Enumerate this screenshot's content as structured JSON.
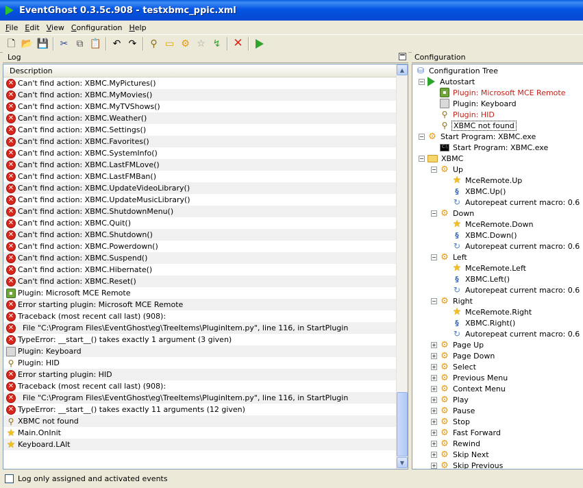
{
  "window": {
    "title": "EventGhost 0.3.5c.908 - testxbmc_ppic.xml"
  },
  "menu": [
    {
      "key": "F",
      "rest": "ile"
    },
    {
      "key": "E",
      "rest": "dit"
    },
    {
      "key": "V",
      "rest": "iew"
    },
    {
      "key": "C",
      "rest": "onfiguration"
    },
    {
      "key": "H",
      "rest": "elp"
    }
  ],
  "toolbar": {
    "icons": [
      "new-file-icon",
      "open-folder-icon",
      "save-icon",
      "cut-icon",
      "copy-icon",
      "paste-icon",
      "undo-icon",
      "redo-icon",
      "add-plugin-icon",
      "add-folder-icon",
      "add-macro-icon",
      "add-event-icon",
      "add-action-icon",
      "disable-icon",
      "execute-icon"
    ]
  },
  "log": {
    "title": "Log",
    "column": "Description",
    "rows": [
      {
        "icon": "error",
        "text": "Can't find action: XBMC.MyPictures()"
      },
      {
        "icon": "error",
        "text": "Can't find action: XBMC.MyMovies()"
      },
      {
        "icon": "error",
        "text": "Can't find action: XBMC.MyTVShows()"
      },
      {
        "icon": "error",
        "text": "Can't find action: XBMC.Weather()"
      },
      {
        "icon": "error",
        "text": "Can't find action: XBMC.Settings()"
      },
      {
        "icon": "error",
        "text": "Can't find action: XBMC.Favorites()"
      },
      {
        "icon": "error",
        "text": "Can't find action: XBMC.SystemInfo()"
      },
      {
        "icon": "error",
        "text": "Can't find action: XBMC.LastFMLove()"
      },
      {
        "icon": "error",
        "text": "Can't find action: XBMC.LastFMBan()"
      },
      {
        "icon": "error",
        "text": "Can't find action: XBMC.UpdateVideoLibrary()"
      },
      {
        "icon": "error",
        "text": "Can't find action: XBMC.UpdateMusicLibrary()"
      },
      {
        "icon": "error",
        "text": "Can't find action: XBMC.ShutdownMenu()"
      },
      {
        "icon": "error",
        "text": "Can't find action: XBMC.Quit()"
      },
      {
        "icon": "error",
        "text": "Can't find action: XBMC.Shutdown()"
      },
      {
        "icon": "error",
        "text": "Can't find action: XBMC.Powerdown()"
      },
      {
        "icon": "error",
        "text": "Can't find action: XBMC.Suspend()"
      },
      {
        "icon": "error",
        "text": "Can't find action: XBMC.Hibernate()"
      },
      {
        "icon": "error",
        "text": "Can't find action: XBMC.Reset()"
      },
      {
        "icon": "plugin",
        "text": "Plugin: Microsoft MCE Remote"
      },
      {
        "icon": "error",
        "text": "Error starting plugin: Microsoft MCE Remote"
      },
      {
        "icon": "error",
        "text": "Traceback (most recent call last) (908):"
      },
      {
        "icon": "error",
        "text": "  File \"C:\\Program Files\\EventGhost\\eg\\TreeItems\\PluginItem.py\", line 116, in StartPlugin"
      },
      {
        "icon": "error",
        "text": "TypeError: __start__() takes exactly 1 argument (3 given)"
      },
      {
        "icon": "keyboard",
        "text": "Plugin: Keyboard"
      },
      {
        "icon": "hid",
        "text": "Plugin: HID"
      },
      {
        "icon": "error",
        "text": "Error starting plugin: HID"
      },
      {
        "icon": "error",
        "text": "Traceback (most recent call last) (908):"
      },
      {
        "icon": "error",
        "text": "  File \"C:\\Program Files\\EventGhost\\eg\\TreeItems\\PluginItem.py\", line 116, in StartPlugin"
      },
      {
        "icon": "error",
        "text": "TypeError: __start__() takes exactly 11 arguments (12 given)"
      },
      {
        "icon": "hid",
        "text": "XBMC not found"
      },
      {
        "icon": "star",
        "text": "Main.OnInit"
      },
      {
        "icon": "star",
        "text": "Keyboard.LAlt"
      }
    ],
    "filter_label": "Log only assigned and activated events",
    "filter_checked": false
  },
  "config": {
    "title": "Configuration",
    "tree": [
      {
        "level": 0,
        "exp": "",
        "icon": "tree",
        "label": "Configuration Tree"
      },
      {
        "level": 1,
        "exp": "-",
        "icon": "play",
        "label": "Autostart"
      },
      {
        "level": 2,
        "exp": "",
        "icon": "plugin",
        "label": "Plugin: Microsoft MCE Remote",
        "style": "red"
      },
      {
        "level": 2,
        "exp": "",
        "icon": "keyboard",
        "label": "Plugin: Keyboard"
      },
      {
        "level": 2,
        "exp": "",
        "icon": "hid",
        "label": "Plugin: HID",
        "style": "red"
      },
      {
        "level": 2,
        "exp": "",
        "icon": "hid",
        "label": "XBMC not found",
        "style": "sel"
      },
      {
        "level": 1,
        "exp": "-",
        "icon": "gear",
        "label": "Start Program: XBMC.exe"
      },
      {
        "level": 2,
        "exp": "",
        "icon": "cmd",
        "label": "Start Program: XBMC.exe"
      },
      {
        "level": 1,
        "exp": "-",
        "icon": "folder",
        "label": "XBMC"
      },
      {
        "level": 2,
        "exp": "-",
        "icon": "gear",
        "label": "Up"
      },
      {
        "level": 3,
        "exp": "",
        "icon": "star",
        "label": "MceRemote.Up"
      },
      {
        "level": 3,
        "exp": "",
        "icon": "python",
        "label": "XBMC.Up()"
      },
      {
        "level": 3,
        "exp": "",
        "icon": "repeat",
        "label": "Autorepeat current macro: 0.6"
      },
      {
        "level": 2,
        "exp": "-",
        "icon": "gear",
        "label": "Down"
      },
      {
        "level": 3,
        "exp": "",
        "icon": "star",
        "label": "MceRemote.Down"
      },
      {
        "level": 3,
        "exp": "",
        "icon": "python",
        "label": "XBMC.Down()"
      },
      {
        "level": 3,
        "exp": "",
        "icon": "repeat",
        "label": "Autorepeat current macro: 0.6"
      },
      {
        "level": 2,
        "exp": "-",
        "icon": "gear",
        "label": "Left"
      },
      {
        "level": 3,
        "exp": "",
        "icon": "star",
        "label": "MceRemote.Left"
      },
      {
        "level": 3,
        "exp": "",
        "icon": "python",
        "label": "XBMC.Left()"
      },
      {
        "level": 3,
        "exp": "",
        "icon": "repeat",
        "label": "Autorepeat current macro: 0.6"
      },
      {
        "level": 2,
        "exp": "-",
        "icon": "gear",
        "label": "Right"
      },
      {
        "level": 3,
        "exp": "",
        "icon": "star",
        "label": "MceRemote.Right"
      },
      {
        "level": 3,
        "exp": "",
        "icon": "python",
        "label": "XBMC.Right()"
      },
      {
        "level": 3,
        "exp": "",
        "icon": "repeat",
        "label": "Autorepeat current macro: 0.6"
      },
      {
        "level": 2,
        "exp": "+",
        "icon": "gear",
        "label": "Page Up"
      },
      {
        "level": 2,
        "exp": "+",
        "icon": "gear",
        "label": "Page Down"
      },
      {
        "level": 2,
        "exp": "+",
        "icon": "gear",
        "label": "Select"
      },
      {
        "level": 2,
        "exp": "+",
        "icon": "gear",
        "label": "Previous Menu"
      },
      {
        "level": 2,
        "exp": "+",
        "icon": "gear",
        "label": "Context Menu"
      },
      {
        "level": 2,
        "exp": "+",
        "icon": "gear",
        "label": "Play"
      },
      {
        "level": 2,
        "exp": "+",
        "icon": "gear",
        "label": "Pause"
      },
      {
        "level": 2,
        "exp": "+",
        "icon": "gear",
        "label": "Stop"
      },
      {
        "level": 2,
        "exp": "+",
        "icon": "gear",
        "label": "Fast Forward"
      },
      {
        "level": 2,
        "exp": "+",
        "icon": "gear",
        "label": "Rewind"
      },
      {
        "level": 2,
        "exp": "+",
        "icon": "gear",
        "label": "Skip Next"
      },
      {
        "level": 2,
        "exp": "+",
        "icon": "gear",
        "label": "Skip Previous"
      }
    ]
  },
  "colors": {
    "titlebar": "#0554e3",
    "error": "#d8261b",
    "disabled_label": "#c3201a",
    "frame": "#ece9d8"
  }
}
